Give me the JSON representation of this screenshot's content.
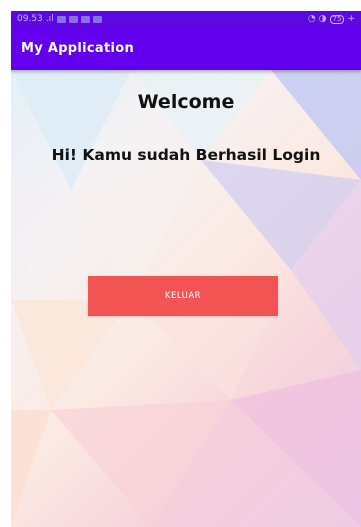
{
  "status_bar": {
    "time": "09.53",
    "signal": ".ıl",
    "battery": "75"
  },
  "app_bar": {
    "title": "My Application"
  },
  "main": {
    "welcome": "Welcome",
    "message": "Hi! Kamu sudah Berhasil Login",
    "logout_button": "KELUAR"
  },
  "colors": {
    "status_bar": "#5b09e0",
    "app_bar": "#6200ee",
    "logout_button": "#f25454"
  }
}
